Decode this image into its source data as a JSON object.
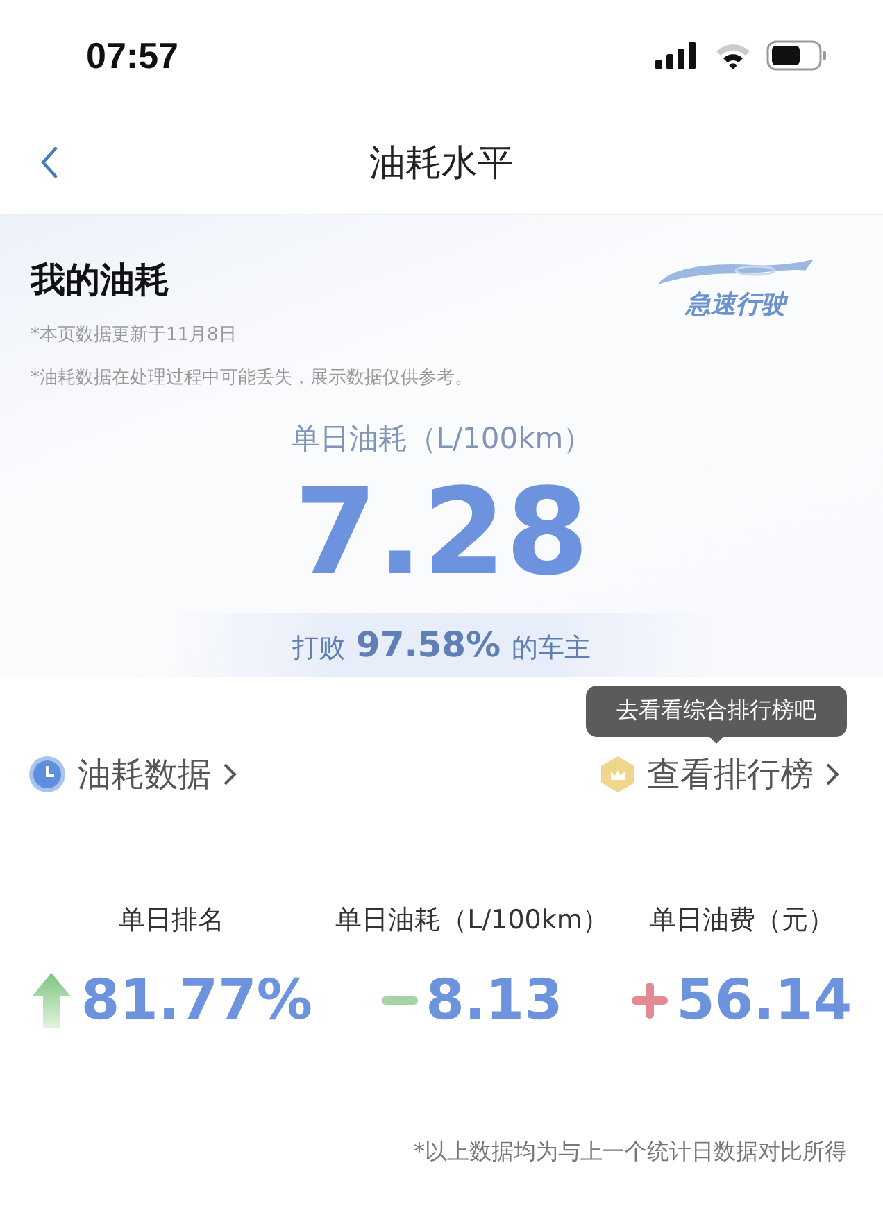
{
  "status_bar": {
    "time": "07:57"
  },
  "nav": {
    "title": "油耗水平"
  },
  "summary": {
    "title": "我的油耗",
    "notes": [
      "*本页数据更新于11月8日",
      "*油耗数据在处理过程中可能丢失，展示数据仅供参考。"
    ],
    "logo_text": "急速行驶",
    "metric_label": "单日油耗（L/100km）",
    "metric_value": "7.28",
    "beat_prefix": "打败",
    "beat_value": "97.58%",
    "beat_suffix": "的车主"
  },
  "tooltip": "去看看综合排行榜吧",
  "links": [
    {
      "kind": "clock",
      "label": "油耗数据"
    },
    {
      "kind": "medal",
      "label": "查看排行榜"
    }
  ],
  "stats": [
    {
      "label": "单日排名",
      "kind": "up",
      "value": "81.77%"
    },
    {
      "label": "单日油耗（L/100km）",
      "kind": "minus",
      "value": "8.13"
    },
    {
      "label": "单日油费（元）",
      "kind": "plus",
      "value": "56.14"
    }
  ],
  "footnote": "*以上数据均为与上一个统计日数据对比所得"
}
